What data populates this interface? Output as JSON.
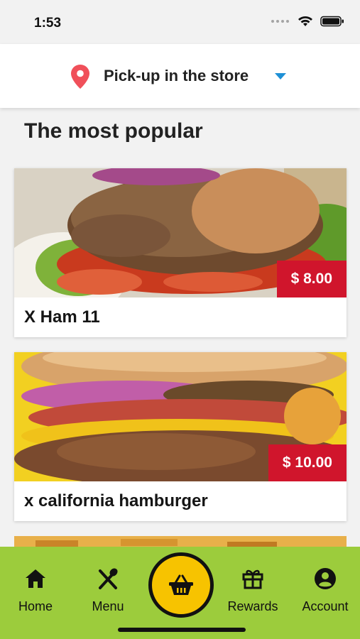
{
  "status_bar": {
    "time": "1:53"
  },
  "header": {
    "location_label": "Pick-up in the store",
    "pin_color": "#f0505a",
    "caret_color": "#1e90d6"
  },
  "section": {
    "title": "The most popular"
  },
  "products": [
    {
      "name": "X Ham 11",
      "price": "$ 8.00"
    },
    {
      "name": "x california hamburger",
      "price": "$ 10.00"
    }
  ],
  "tabs": [
    {
      "label": "Home",
      "icon": "home-icon"
    },
    {
      "label": "Menu",
      "icon": "utensils-icon"
    },
    {
      "label": "Rewards",
      "icon": "gift-icon"
    },
    {
      "label": "Account",
      "icon": "account-icon"
    }
  ],
  "cart": {
    "icon": "basket-icon"
  },
  "colors": {
    "price_badge": "#d0152c",
    "tab_bar": "#9ccc3c",
    "cart_button": "#f7c300"
  }
}
